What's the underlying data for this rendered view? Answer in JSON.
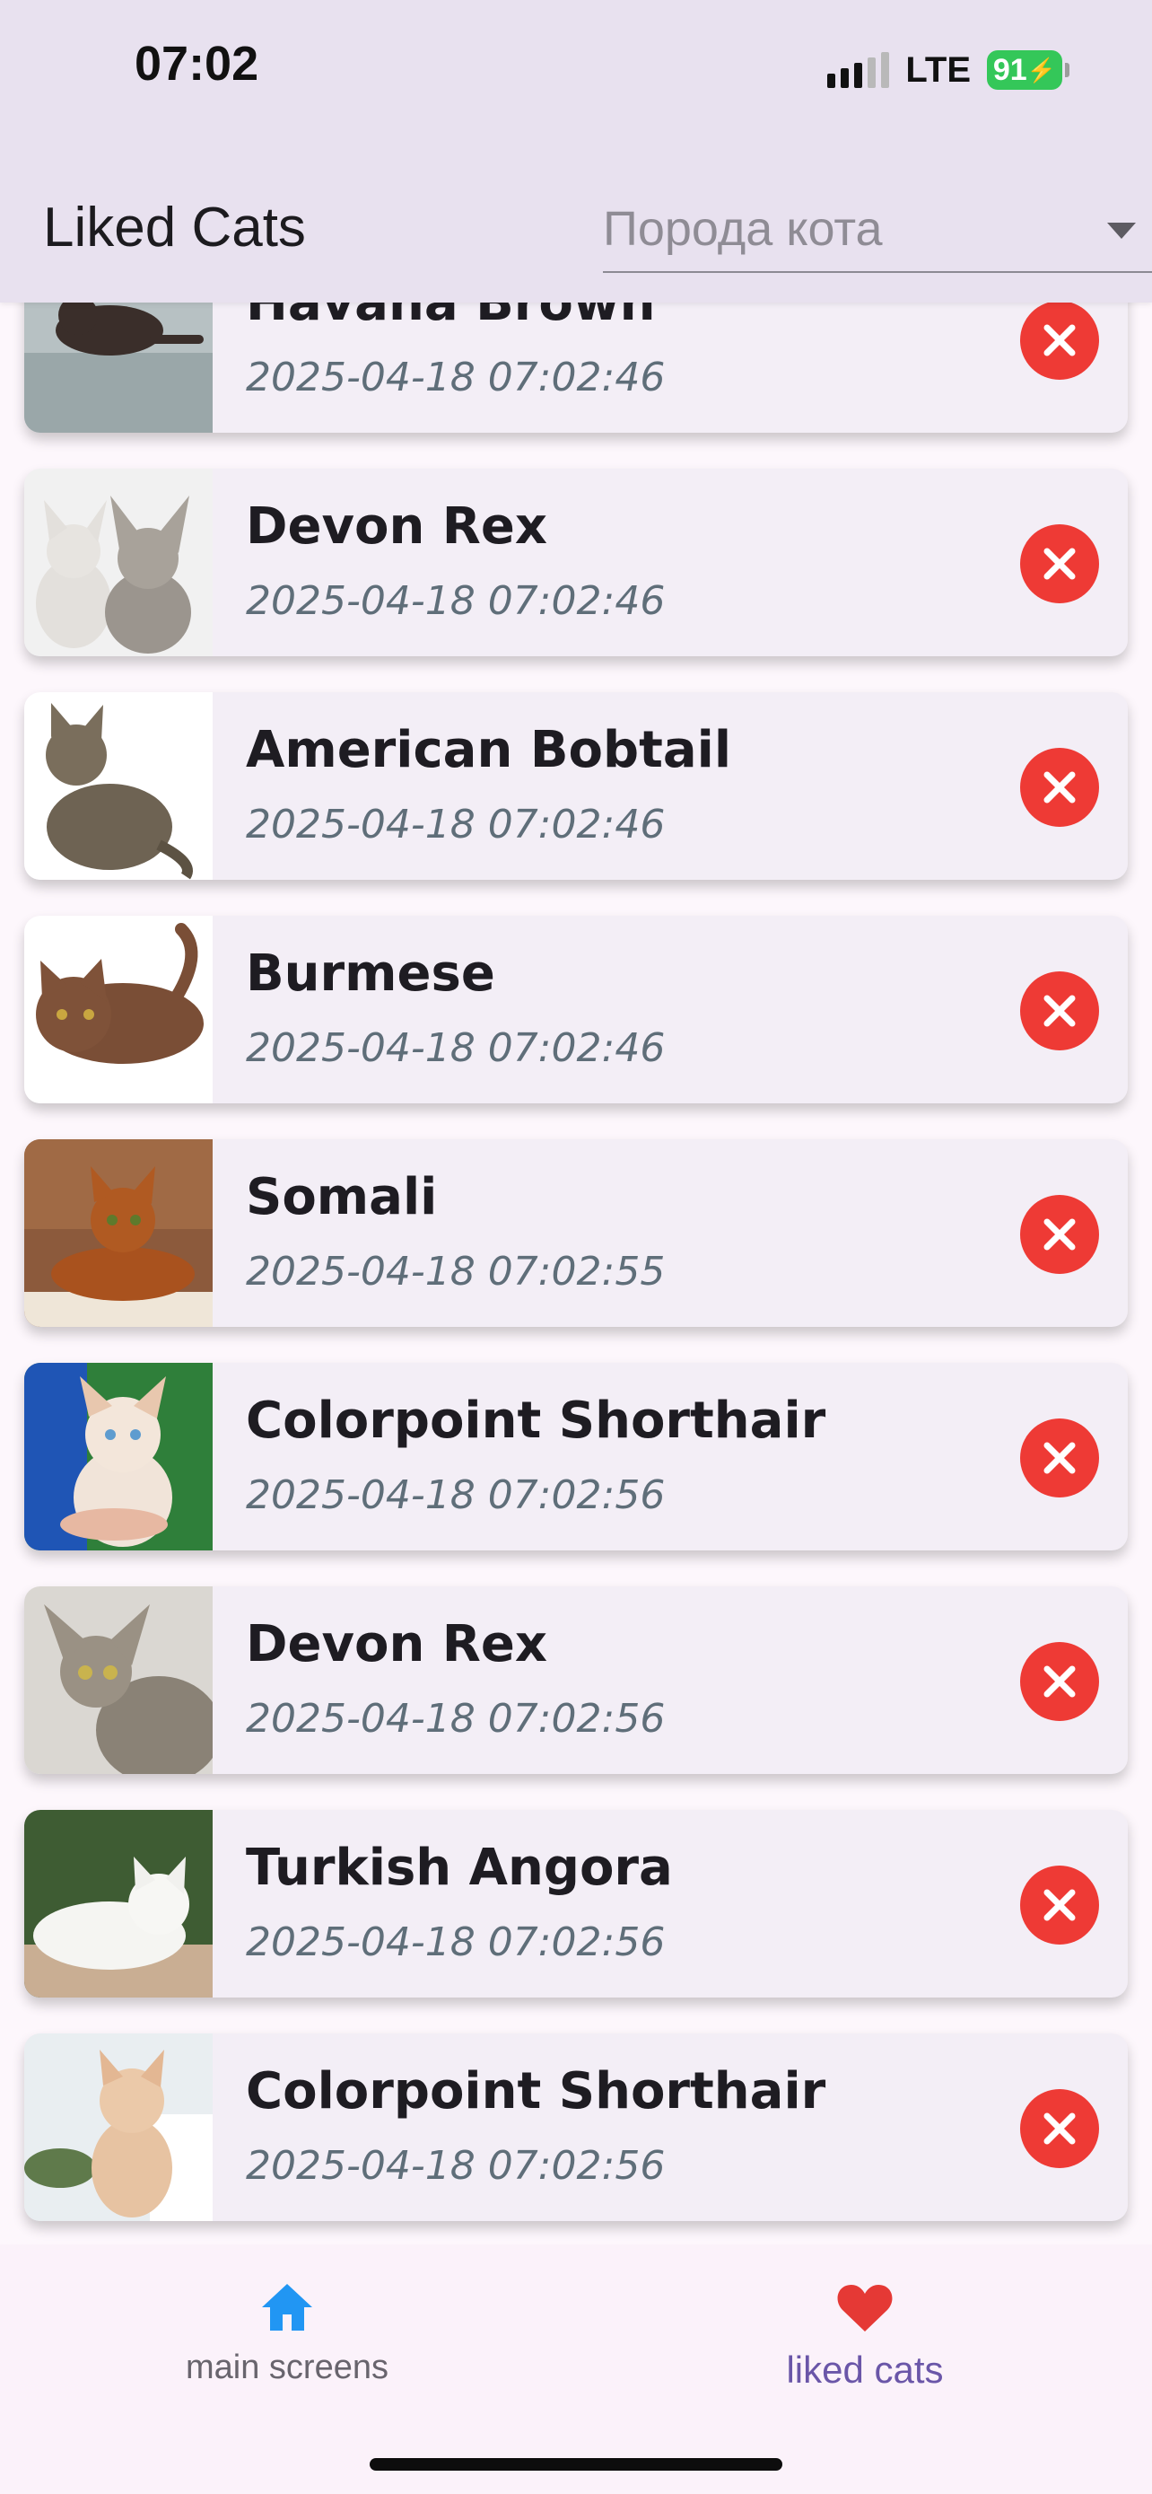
{
  "status_bar": {
    "time": "07:02",
    "network": "LTE",
    "battery": "91"
  },
  "app_bar": {
    "title": "Liked Cats",
    "breed_placeholder": "Порода кота"
  },
  "liked_cats": [
    {
      "name": "Havana Brown",
      "time": "2025-04-18 07:02:46"
    },
    {
      "name": "Devon Rex",
      "time": "2025-04-18 07:02:46"
    },
    {
      "name": "American Bobtail",
      "time": "2025-04-18 07:02:46"
    },
    {
      "name": "Burmese",
      "time": "2025-04-18 07:02:46"
    },
    {
      "name": "Somali",
      "time": "2025-04-18 07:02:55"
    },
    {
      "name": "Colorpoint Shorthair",
      "time": "2025-04-18 07:02:56"
    },
    {
      "name": "Devon Rex",
      "time": "2025-04-18 07:02:56"
    },
    {
      "name": "Turkish Angora",
      "time": "2025-04-18 07:02:56"
    },
    {
      "name": "Colorpoint Shorthair",
      "time": "2025-04-18 07:02:56"
    }
  ],
  "bottom_nav": {
    "home_label": "main screens",
    "liked_label": "liked cats"
  },
  "icons": {
    "home": "home-icon",
    "liked": "heart-icon",
    "remove": "remove-circle-icon"
  },
  "colors": {
    "accent_blue": "#2196F3",
    "heart_red": "#E53935",
    "remove_red": "#EE3A35",
    "app_bar": "#E8E1EF",
    "selected_label": "#6A56A8"
  }
}
